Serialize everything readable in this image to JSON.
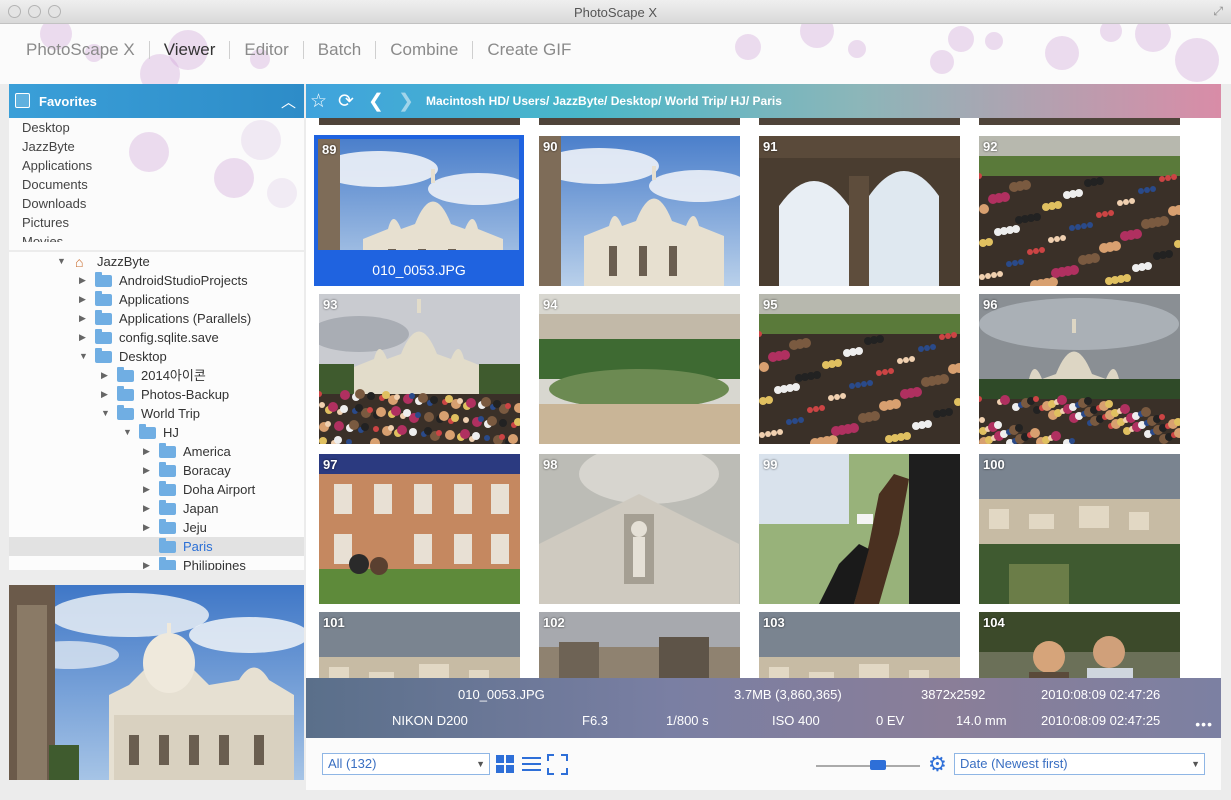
{
  "window": {
    "title": "PhotoScape X"
  },
  "menu": {
    "items": [
      "PhotoScape X",
      "Viewer",
      "Editor",
      "Batch",
      "Combine",
      "Create GIF"
    ],
    "active": "Viewer"
  },
  "favorites": {
    "title": "Favorites",
    "items": [
      "Desktop",
      "JazzByte",
      "Applications",
      "Documents",
      "Downloads",
      "Pictures",
      "Movies"
    ]
  },
  "tree": [
    {
      "label": "JazzByte",
      "level": 0,
      "expanded": true,
      "icon": "home-icon"
    },
    {
      "label": "AndroidStudioProjects",
      "level": 1,
      "expanded": false,
      "icon": "folder-icon"
    },
    {
      "label": "Applications",
      "level": 1,
      "expanded": false,
      "icon": "folder-icon"
    },
    {
      "label": "Applications (Parallels)",
      "level": 1,
      "expanded": false,
      "icon": "folder-icon"
    },
    {
      "label": "config.sqlite.save",
      "level": 1,
      "expanded": false,
      "icon": "folder-icon"
    },
    {
      "label": "Desktop",
      "level": 1,
      "expanded": true,
      "icon": "folder-icon"
    },
    {
      "label": "2014아이콘",
      "level": 2,
      "expanded": false,
      "icon": "folder-icon"
    },
    {
      "label": "Photos-Backup",
      "level": 2,
      "expanded": false,
      "icon": "folder-icon"
    },
    {
      "label": "World Trip",
      "level": 2,
      "expanded": true,
      "icon": "folder-icon"
    },
    {
      "label": "HJ",
      "level": 3,
      "expanded": true,
      "icon": "folder-icon"
    },
    {
      "label": "America",
      "level": 4,
      "expanded": false,
      "icon": "folder-icon"
    },
    {
      "label": "Boracay",
      "level": 4,
      "expanded": false,
      "icon": "folder-icon"
    },
    {
      "label": "Doha Airport",
      "level": 4,
      "expanded": false,
      "icon": "folder-icon"
    },
    {
      "label": "Japan",
      "level": 4,
      "expanded": false,
      "icon": "folder-icon"
    },
    {
      "label": "Jeju",
      "level": 4,
      "expanded": false,
      "icon": "folder-icon"
    },
    {
      "label": "Paris",
      "level": 4,
      "expanded": null,
      "icon": "folder-icon",
      "selected": true
    },
    {
      "label": "Philippines",
      "level": 4,
      "expanded": false,
      "icon": "folder-icon"
    }
  ],
  "pathbar": {
    "path": "Macintosh HD/ Users/ JazzByte/ Desktop/ World Trip/ HJ/ Paris"
  },
  "thumbnails": [
    {
      "num": "89",
      "kind": "basilica-sky",
      "selected": true,
      "filename": "010_0053.JPG"
    },
    {
      "num": "90",
      "kind": "basilica-sky"
    },
    {
      "num": "91",
      "kind": "arches"
    },
    {
      "num": "92",
      "kind": "crowd"
    },
    {
      "num": "93",
      "kind": "basilica-crowd"
    },
    {
      "num": "94",
      "kind": "city-park"
    },
    {
      "num": "95",
      "kind": "crowd"
    },
    {
      "num": "96",
      "kind": "basilica-gray"
    },
    {
      "num": "97",
      "kind": "building"
    },
    {
      "num": "98",
      "kind": "sculpture"
    },
    {
      "num": "99",
      "kind": "hands"
    },
    {
      "num": "100",
      "kind": "cityscape"
    },
    {
      "num": "101",
      "kind": "cityscape"
    },
    {
      "num": "102",
      "kind": "rooftops"
    },
    {
      "num": "103",
      "kind": "cityscape"
    },
    {
      "num": "104",
      "kind": "people"
    }
  ],
  "info": {
    "filename": "010_0053.JPG",
    "filesize": "3.7MB (3,860,365)",
    "dimensions": "3872x2592",
    "date1": "2010:08:09 02:47:26",
    "camera": "NIKON D200",
    "aperture": "F6.3",
    "shutter": "1/800 s",
    "iso": "ISO 400",
    "ev": "0 EV",
    "focal": "14.0 mm",
    "date2": "2010:08:09 02:47:25"
  },
  "bottom": {
    "filter": "All (132)",
    "sort": "Date (Newest first)",
    "zoom": 0.6
  },
  "colors": {
    "accent": "#2e6fd8",
    "selection": "#1f63e0"
  }
}
